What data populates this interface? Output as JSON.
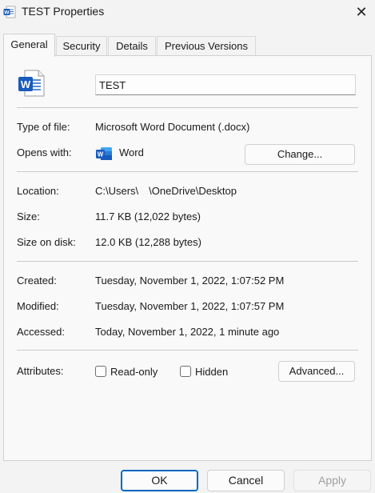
{
  "window": {
    "title": "TEST Properties",
    "close_glyph": "✕"
  },
  "tabs": [
    {
      "label": "General",
      "active": true
    },
    {
      "label": "Security",
      "active": false
    },
    {
      "label": "Details",
      "active": false
    },
    {
      "label": "Previous Versions",
      "active": false
    }
  ],
  "general": {
    "file_name": "TEST",
    "file_icon": "word-document-icon",
    "type_label": "Type of file:",
    "type_value": "Microsoft Word Document (.docx)",
    "opens_label": "Opens with:",
    "opens_value": "Word",
    "change_button": "Change...",
    "location_label": "Location:",
    "location_value": "C:\\Users\\     \\OneDrive\\Desktop",
    "size_label": "Size:",
    "size_value": "11.7 KB (12,022 bytes)",
    "size_on_disk_label": "Size on disk:",
    "size_on_disk_value": "12.0 KB (12,288 bytes)",
    "created_label": "Created:",
    "created_value": "Tuesday, November 1, 2022, 1:07:52 PM",
    "modified_label": "Modified:",
    "modified_value": "Tuesday, November 1, 2022, 1:07:57 PM",
    "accessed_label": "Accessed:",
    "accessed_value": "Today, November 1, 2022, 1 minute ago",
    "attributes_label": "Attributes:",
    "readonly_label": "Read-only",
    "readonly_checked": false,
    "hidden_label": "Hidden",
    "hidden_checked": false,
    "advanced_button": "Advanced..."
  },
  "footer": {
    "ok": "OK",
    "cancel": "Cancel",
    "apply": "Apply"
  },
  "colors": {
    "word_blue": "#185abd",
    "accent": "#0067c0",
    "background": "#f3f3f3"
  }
}
